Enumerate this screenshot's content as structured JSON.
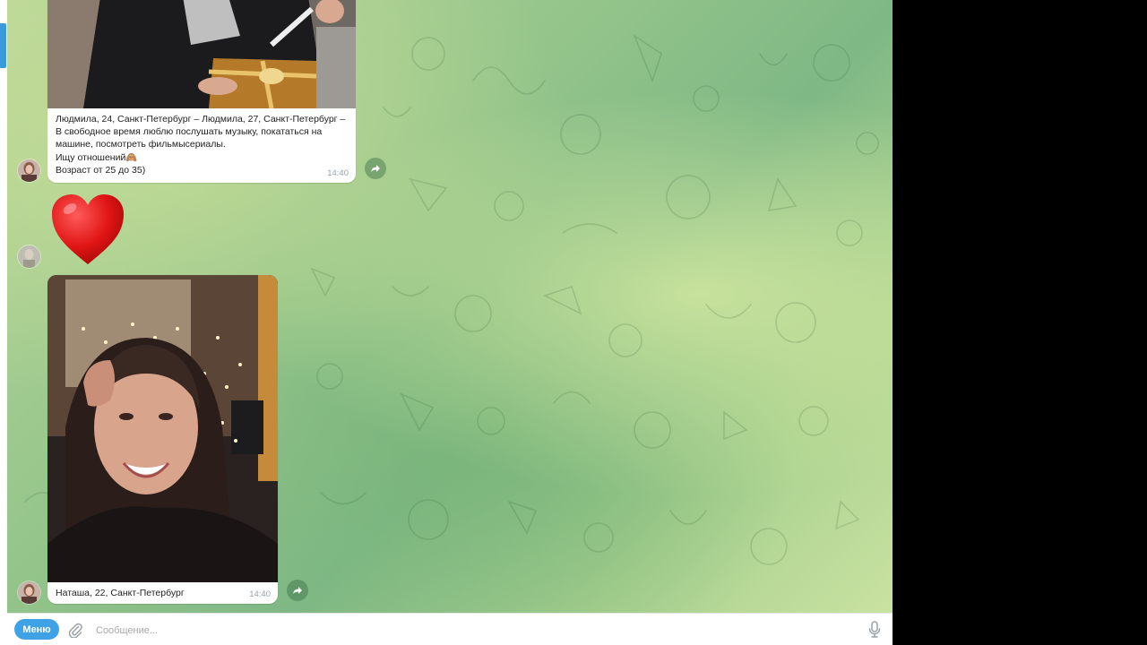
{
  "messages": [
    {
      "caption_lines": [
        "Людмила, 24, Санкт-Петербург – Людмила, 27, Санкт-Петербург –",
        "В свободное время люблю послушать музыку, покататься на",
        "машине, посмотреть фильмысериалы.",
        "Ищу отношений🙈",
        "Возраст от 25 до 35)"
      ],
      "time": "14:40"
    },
    {
      "sticker": "heart-emoji"
    },
    {
      "caption_lines": [
        "Наташа, 22, Санкт-Петербург"
      ],
      "time": "14:40"
    }
  ],
  "composer": {
    "menu_label": "Меню",
    "placeholder": "Сообщение..."
  },
  "icons": {
    "forward": "forward-arrow-icon",
    "attach": "paperclip-icon",
    "mic": "microphone-icon"
  },
  "colors": {
    "accent": "#3fa2e6",
    "bubble": "#ffffff",
    "time": "#9aa3a9"
  }
}
